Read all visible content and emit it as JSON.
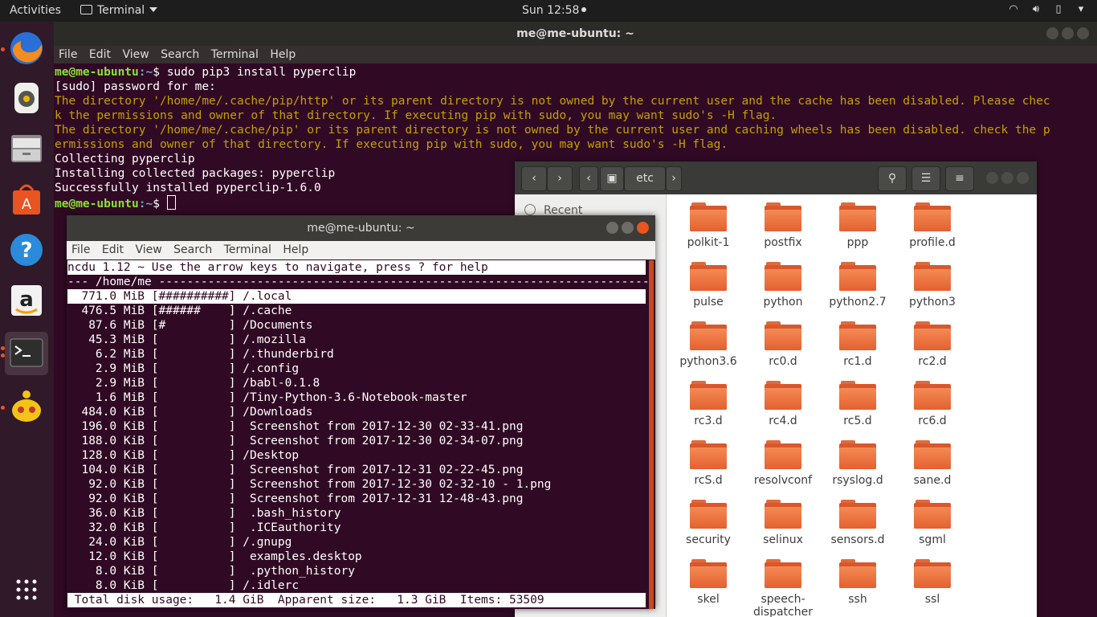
{
  "topbar": {
    "activities": "Activities",
    "app_name": "Terminal",
    "clock": "Sun 12:58"
  },
  "dock": {
    "items": [
      "firefox-icon",
      "rhythmbox-icon",
      "files-icon",
      "software-center-icon",
      "help-icon",
      "amazon-icon",
      "terminal-icon",
      "hexchat-icon"
    ],
    "apps_grid": "show-applications-icon"
  },
  "term1": {
    "title": "me@me-ubuntu: ~",
    "menu": [
      "File",
      "Edit",
      "View",
      "Search",
      "Terminal",
      "Help"
    ],
    "prompt_user": "me@me-ubuntu",
    "prompt_path": ":~",
    "command": "$ sudo pip3 install pyperclip",
    "lines": [
      "[sudo] password for me:",
      "The directory '/home/me/.cache/pip/http' or its parent directory is not owned by the current user and the cache has been disabled. Please chec",
      "k the permissions and owner of that directory. If executing pip with sudo, you may want sudo's -H flag.",
      "The directory '/home/me/.cache/pip' or its parent directory is not owned by the current user and caching wheels has been disabled. check the p",
      "ermissions and owner of that directory. If executing pip with sudo, you may want sudo's -H flag.",
      "Collecting pyperclip",
      "Installing collected packages: pyperclip",
      "Successfully installed pyperclip-1.6.0"
    ],
    "prompt2_end": "$ "
  },
  "filemanager": {
    "location": "etc",
    "sidebar_recent": "Recent",
    "folders": [
      "polkit-1",
      "postfix",
      "ppp",
      "profile.d",
      "pulse",
      "python",
      "python2.7",
      "python3",
      "python3.6",
      "rc0.d",
      "rc1.d",
      "rc2.d",
      "rc3.d",
      "rc4.d",
      "rc5.d",
      "rc6.d",
      "rcS.d",
      "resolvconf",
      "rsyslog.d",
      "sane.d",
      "security",
      "selinux",
      "sensors.d",
      "sgml",
      "skel",
      "speech-\ndispatcher",
      "ssh",
      "ssl"
    ]
  },
  "term2": {
    "title": "me@me-ubuntu: ~",
    "menu": [
      "File",
      "Edit",
      "View",
      "Search",
      "Terminal",
      "Help"
    ],
    "header": "ncdu 1.12 ~ Use the arrow keys to navigate, press ? for help",
    "path_line": "--- /home/me ----------------------------------------------------------------------",
    "rows": [
      "  771.0 MiB [##########] /.local",
      "  476.5 MiB [######    ] /.cache",
      "   87.6 MiB [#         ] /Documents",
      "   45.3 MiB [          ] /.mozilla",
      "    6.2 MiB [          ] /.thunderbird",
      "    2.9 MiB [          ] /.config",
      "    2.9 MiB [          ] /babl-0.1.8",
      "    1.6 MiB [          ] /Tiny-Python-3.6-Notebook-master",
      "  484.0 KiB [          ] /Downloads",
      "  196.0 KiB [          ]  Screenshot from 2017-12-30 02-33-41.png",
      "  188.0 KiB [          ]  Screenshot from 2017-12-30 02-34-07.png",
      "  128.0 KiB [          ] /Desktop",
      "  104.0 KiB [          ]  Screenshot from 2017-12-31 02-22-45.png",
      "   92.0 KiB [          ]  Screenshot from 2017-12-30 02-32-10 - 1.png",
      "   92.0 KiB [          ]  Screenshot from 2017-12-31 12-48-43.png",
      "   36.0 KiB [          ]  .bash_history",
      "   32.0 KiB [          ]  .ICEauthority",
      "   24.0 KiB [          ] /.gnupg",
      "   12.0 KiB [          ]  examples.desktop",
      "    8.0 KiB [          ]  .python_history",
      "    8.0 KiB [          ] /.idlerc"
    ],
    "footer": " Total disk usage:   1.4 GiB  Apparent size:   1.3 GiB  Items: 53509"
  }
}
